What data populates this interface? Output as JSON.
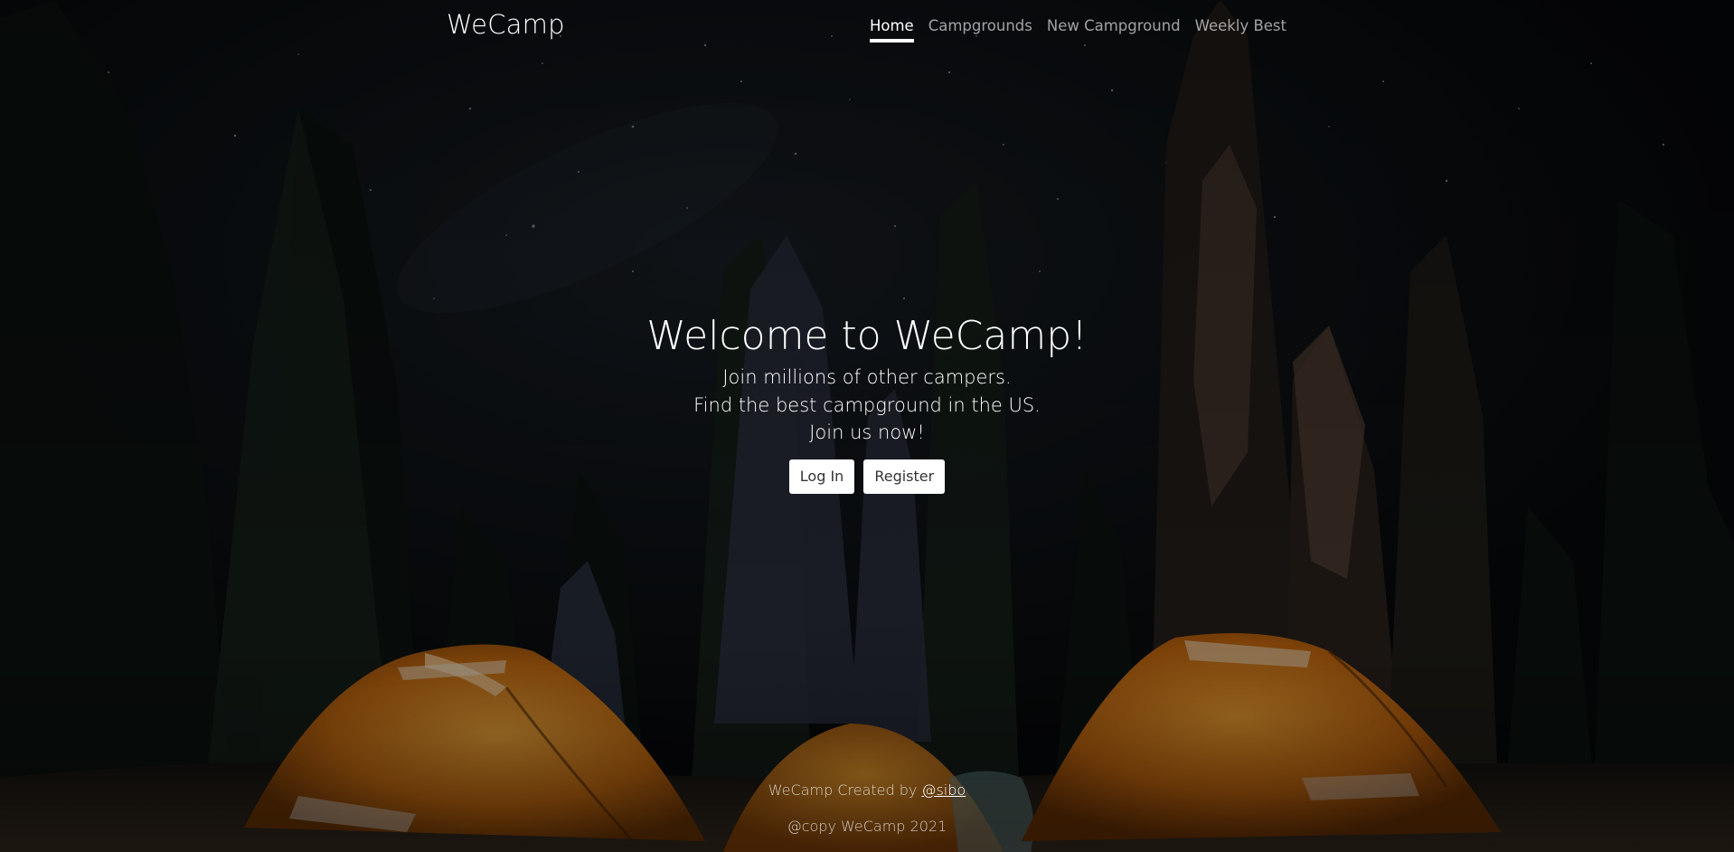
{
  "header": {
    "brand": "WeCamp",
    "nav": [
      {
        "label": "Home",
        "active": true
      },
      {
        "label": "Campgrounds",
        "active": false
      },
      {
        "label": "New Campground",
        "active": false
      },
      {
        "label": "Weekly Best",
        "active": false
      }
    ]
  },
  "hero": {
    "title": "Welcome to WeCamp!",
    "lines": [
      "Join millions of other campers.",
      "Find the best campground in the US.",
      "Join us now!"
    ],
    "login_label": "Log In",
    "register_label": "Register"
  },
  "footer": {
    "created_by_prefix": "WeCamp Created by",
    "author_link": "@sibo",
    "copyright": "@copy WeCamp 2021"
  },
  "colors": {
    "sky": "#0b0e12",
    "tent_orange": "#d87a12",
    "button_bg": "#ffffff",
    "button_text": "#333333"
  },
  "background_image": "night-forest-campsite-with-orange-tents"
}
